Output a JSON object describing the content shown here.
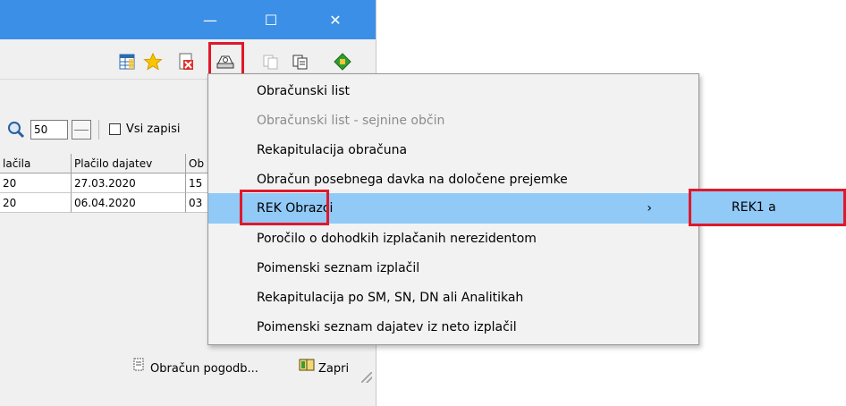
{
  "window": {
    "controls": {
      "minimize": "—",
      "maximize": "☐",
      "close": "✕"
    }
  },
  "filter": {
    "count_value": "50",
    "all_records_label": "Vsi zapisi"
  },
  "grid": {
    "headers": [
      "lačila",
      "Plačilo dajatev",
      "Ob"
    ],
    "rows": [
      [
        "20",
        "27.03.2020",
        "15"
      ],
      [
        "20",
        "06.04.2020",
        "03"
      ]
    ]
  },
  "buttons": {
    "contract_calc": "Obračun pogodb...",
    "close": "Zapri"
  },
  "menu": {
    "items": [
      {
        "label": "Obračunski list",
        "state": "enabled"
      },
      {
        "label": "Obračunski list - sejnine občin",
        "state": "disabled"
      },
      {
        "label": "Rekapitulacija obračuna",
        "state": "enabled"
      },
      {
        "label": "Obračun posebnega davka na določene prejemke",
        "state": "enabled"
      },
      {
        "label": "REK Obrazci",
        "state": "active"
      },
      {
        "label": "Poročilo o dohodkih izplačanih nerezidentom",
        "state": "enabled"
      },
      {
        "label": "Poimenski seznam izplačil",
        "state": "enabled"
      },
      {
        "label": "Rekapitulacija po SM, SN, DN ali Analitikah",
        "state": "enabled"
      },
      {
        "label": "Poimenski seznam dajatev iz neto izplačil",
        "state": "enabled"
      }
    ],
    "submenu_arrow": "›"
  },
  "submenu": {
    "items": [
      {
        "label": "REK1 a"
      }
    ]
  },
  "colors": {
    "titlebar": "#3c8fe6",
    "highlight_border": "#e0182b",
    "menu_hover": "#91c9f7"
  }
}
